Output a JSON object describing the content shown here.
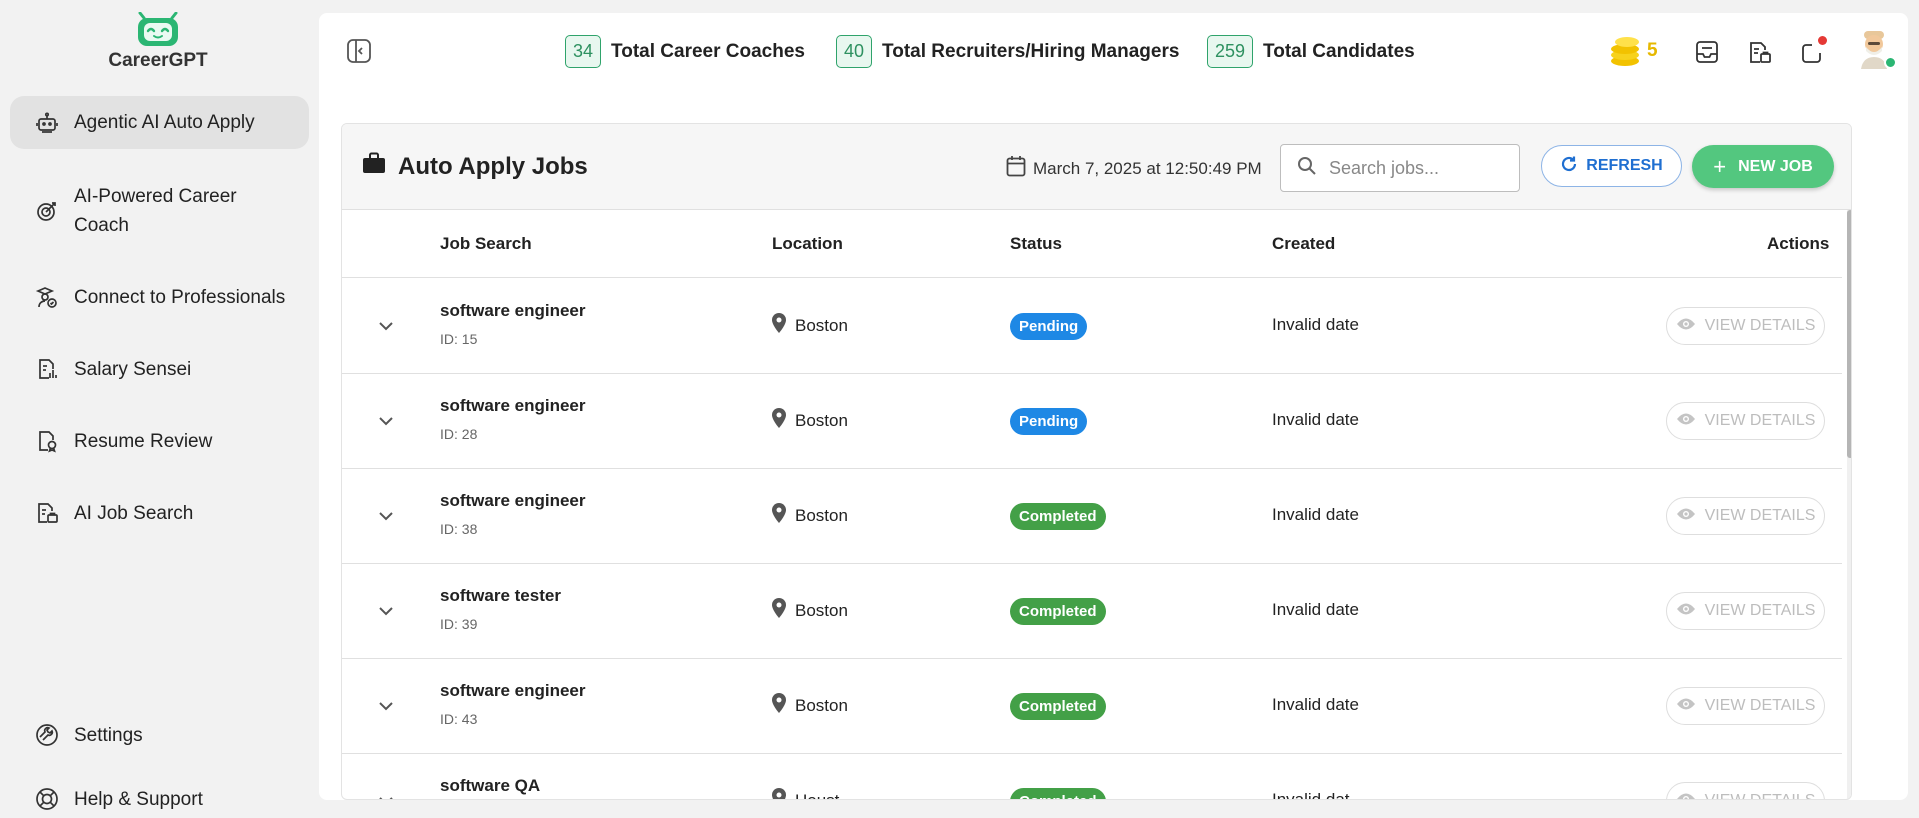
{
  "app": {
    "name": "CareerGPT"
  },
  "sidebar": {
    "items": [
      {
        "label": "Agentic AI Auto Apply",
        "icon": "robot-icon",
        "active": true
      },
      {
        "label": "AI-Powered Career Coach",
        "icon": "target-icon",
        "active": false
      },
      {
        "label": "Connect to Professionals",
        "icon": "graduate-icon",
        "active": false
      },
      {
        "label": "Salary Sensei",
        "icon": "report-chart-icon",
        "active": false
      },
      {
        "label": "Resume Review",
        "icon": "document-badge-icon",
        "active": false
      },
      {
        "label": "AI Job Search",
        "icon": "briefcase-doc-icon",
        "active": false
      }
    ],
    "footer": [
      {
        "label": "Settings",
        "icon": "wrench-icon"
      },
      {
        "label": "Help & Support",
        "icon": "lifebuoy-icon"
      }
    ]
  },
  "header": {
    "stats": [
      {
        "count": "34",
        "label": "Total Career Coaches"
      },
      {
        "count": "40",
        "label": "Total Recruiters/Hiring Managers"
      },
      {
        "count": "259",
        "label": "Total Candidates"
      }
    ],
    "coins": "5"
  },
  "jobs": {
    "title": "Auto Apply Jobs",
    "timestamp": "March 7, 2025 at 12:50:49 PM",
    "search_placeholder": "Search jobs...",
    "refresh_label": "REFRESH",
    "new_job_label": "NEW JOB",
    "columns": [
      "Job Search",
      "Location",
      "Status",
      "Created",
      "Actions"
    ],
    "rows": [
      {
        "title": "software engineer",
        "id": "ID: 15",
        "location": "Boston",
        "status": "Pending",
        "created": "Invalid date",
        "action": "VIEW DETAILS"
      },
      {
        "title": "software engineer",
        "id": "ID: 28",
        "location": "Boston",
        "status": "Pending",
        "created": "Invalid date",
        "action": "VIEW DETAILS"
      },
      {
        "title": "software engineer",
        "id": "ID: 38",
        "location": "Boston",
        "status": "Completed",
        "created": "Invalid date",
        "action": "VIEW DETAILS"
      },
      {
        "title": "software tester",
        "id": "ID: 39",
        "location": "Boston",
        "status": "Completed",
        "created": "Invalid date",
        "action": "VIEW DETAILS"
      },
      {
        "title": "software engineer",
        "id": "ID: 43",
        "location": "Boston",
        "status": "Completed",
        "created": "Invalid date",
        "action": "VIEW DETAILS"
      },
      {
        "title": "software QA",
        "id": "",
        "location": "Houst",
        "status": "Completed",
        "created": "Invalid dat",
        "action": "VIEW DETAILS"
      }
    ]
  },
  "colors": {
    "pending": "#1e88e5",
    "completed": "#43a047",
    "accent_green": "#53c77f",
    "accent_blue": "#1f6fd1"
  }
}
